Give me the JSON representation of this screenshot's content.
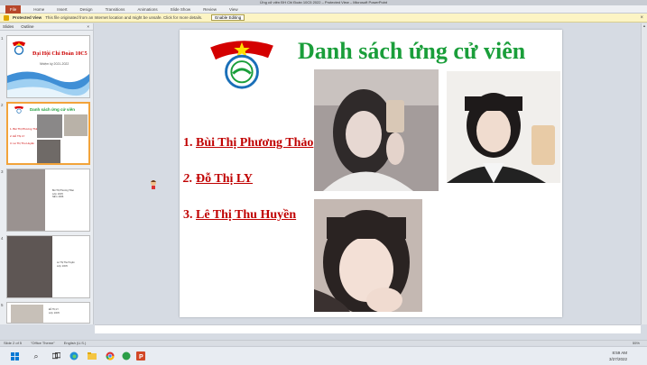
{
  "window": {
    "title": "Ứng cử viên ĐH Chi Đoàn 10C5 2022 – Protected View – Microsoft PowerPoint"
  },
  "ribbon": {
    "tabs": [
      "File",
      "Home",
      "Insert",
      "Design",
      "Transitions",
      "Animations",
      "Slide Show",
      "Review",
      "View"
    ]
  },
  "protected_bar": {
    "title": "Protected View",
    "message": "This file originated from an Internet location and might be unsafe. Click for more details.",
    "button": "Enable Editing"
  },
  "left_pane": {
    "tabs": [
      "Slides",
      "Outline"
    ],
    "slides": [
      {
        "num": "1",
        "title": "Đại Hội Chi Đoàn 10C5",
        "subtitle": "Nhiệm kỳ 2021-2022"
      },
      {
        "num": "2",
        "title": "Danh sách ứng cử viên",
        "items": [
          "1. Bùi Thị Phương Thảo",
          "2. Đỗ Thị LY",
          "3. Lê Thị Thu Huyền"
        ]
      },
      {
        "num": "3",
        "caption": [
          "Bùi Thị Phương Thảo",
          "Lớp: 10C5",
          "Năm: 2006"
        ]
      },
      {
        "num": "4",
        "caption": [
          "Lê Thị Thu Huyền",
          "Lớp: 10C5"
        ]
      },
      {
        "num": "5",
        "caption": [
          "Đỗ Thị LY",
          "Lớp: 10C5"
        ]
      }
    ]
  },
  "slide": {
    "title": "Danh sách ứng cử viên",
    "candidates": [
      {
        "num": "1.",
        "name": "Bùi Thị Phương Thảo"
      },
      {
        "num": "2.",
        "name": "Đỗ Thị LY"
      },
      {
        "num": "3.",
        "name": "Lê Thị Thu Huyền"
      }
    ]
  },
  "status_bar": {
    "slide_info": "Slide 2 of 5",
    "theme": "\"Office Theme\"",
    "language": "English (U.S.)",
    "zoom": "55%"
  },
  "taskbar": {
    "time": "8:59 AM",
    "date": "3/27/2022"
  },
  "colors": {
    "title_green": "#1a9e3a",
    "candidate_red": "#c00000",
    "selected_thumb": "#f2a33a"
  }
}
